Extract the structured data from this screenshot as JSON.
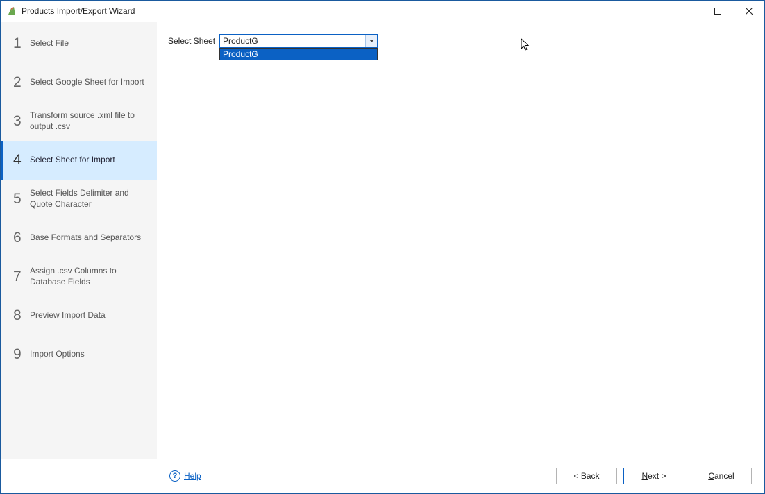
{
  "window": {
    "title": "Products Import/Export Wizard"
  },
  "sidebar": {
    "steps": [
      {
        "num": "1",
        "label": "Select File"
      },
      {
        "num": "2",
        "label": "Select Google Sheet for Import"
      },
      {
        "num": "3",
        "label": "Transform source .xml file to output .csv"
      },
      {
        "num": "4",
        "label": "Select Sheet for Import"
      },
      {
        "num": "5",
        "label": "Select Fields Delimiter and Quote Character"
      },
      {
        "num": "6",
        "label": "Base Formats and Separators"
      },
      {
        "num": "7",
        "label": "Assign .csv Columns to Database Fields"
      },
      {
        "num": "8",
        "label": "Preview Import Data"
      },
      {
        "num": "9",
        "label": "Import Options"
      }
    ],
    "activeIndex": 3
  },
  "content": {
    "selectSheetLabel": "Select Sheet",
    "selectedSheet": "ProductG",
    "dropdownOptions": [
      "ProductG"
    ]
  },
  "footer": {
    "help": "Help",
    "back": "< Back",
    "nextPrefix": "N",
    "nextSuffix": "ext >",
    "cancelPrefix": "C",
    "cancelSuffix": "ancel"
  }
}
